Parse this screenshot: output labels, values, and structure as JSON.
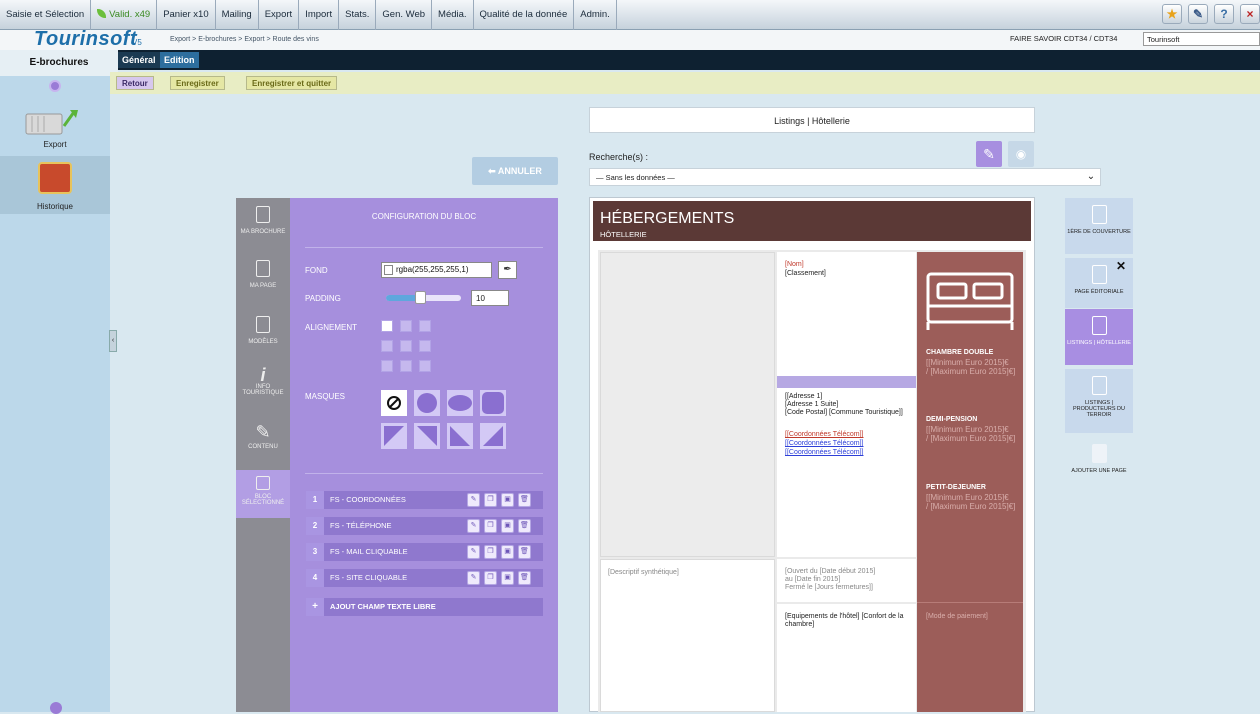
{
  "menu": {
    "items": [
      "Saisie et Sélection",
      "Valid. x49",
      "Panier x10",
      "Mailing",
      "Export",
      "Import",
      "Stats.",
      "Gen. Web",
      "Média.",
      "Qualité de la donnée",
      "Admin."
    ]
  },
  "top_icons": [
    "star-icon",
    "wrench-icon",
    "help-icon",
    "close-icon"
  ],
  "app": {
    "logo": "Tourinsoft",
    "version": "V5",
    "breadcrumb": "Export > E-brochures > Export > Route des vins",
    "org": "FAIRE SAVOIR CDT34 / CDT34",
    "org_select": "Tourinsoft"
  },
  "tabs": {
    "general": "Général",
    "edition": "Edition"
  },
  "sidebar": {
    "title": "E-brochures",
    "export_label": "Export",
    "historique_label": "Historique"
  },
  "actions": {
    "retour": "Retour",
    "enregistrer": "Enregistrer",
    "enregistrer_quitter": "Enregistrer et quitter"
  },
  "annuler_label": "ANNULER",
  "config": {
    "tabs": [
      "MA BROCHURE",
      "MA PAGE",
      "MODÈLES",
      "INFO TOURISTIQUE",
      "CONTENU",
      "BLOC SÉLECTIONNÉ"
    ],
    "title": "CONFIGURATION DU BLOC",
    "fond_label": "FOND",
    "fond_value": "rgba(255,255,255,1)",
    "padding_label": "PADDING",
    "padding_value": "10",
    "padding_level": 0.45,
    "alignement_label": "ALIGNEMENT",
    "masques_label": "MASQUES",
    "fields": [
      {
        "num": "1",
        "label": "FS - COORDONNÉES"
      },
      {
        "num": "2",
        "label": "FS - TÉLÉPHONE"
      },
      {
        "num": "3",
        "label": "FS - MAIL CLIQUABLE"
      },
      {
        "num": "4",
        "label": "FS - SITE CLIQUABLE"
      }
    ],
    "add_field": "AJOUT CHAMP TEXTE LIBRE"
  },
  "main": {
    "listings_title": "Listings | Hôtellerie",
    "search_label": "Recherche(s) :",
    "search_value": "— Sans les données —"
  },
  "doc": {
    "title": "HÉBERGEMENTS",
    "subtitle": "HÔTELLERIE",
    "nom": "[Nom]",
    "classement": "[Classement]",
    "adresse": "[[Adresse 1]\n[Adresse 1 Suite]\n[Code Postal] [Commune Touristique]]",
    "tel1": "[[Coordonnées Télécom]]",
    "tel2": "[[Coordonnées Télécom]]",
    "tel3": "[[Coordonnées Télécom]]",
    "ch_title": "CHAMBRE DOUBLE",
    "ch_val": "[[Minimum Euro 2015]€\n/ [Maximum Euro 2015]€]",
    "dp_title": "DEMI-PENSION",
    "dp_val": "[[Minimum Euro 2015]€\n/ [Maximum Euro 2015]€]",
    "pd_title": "PETIT-DEJEUNER",
    "pd_val": "[[Minimum Euro 2015]€\n/ [Maximum Euro 2015]€]",
    "descriptif": "[Descriptif synthétique]",
    "ouverture": "[Ouvert du [Date début 2015]\nau [Date fin 2015]\nFermé le [Jours fermetures]]",
    "equipements": "[Equipements de l'hôtel] [Confort de la chambre]",
    "paiement": "[Mode de paiement]"
  },
  "pages": [
    "1ÈRE DE COUVERTURE",
    "PAGE ÉDITORIALE",
    "LISTINGS | HÔTELLERIE",
    "LISTINGS | PRODUCTEURS DU TERROIR",
    "AJOUTER UNE PAGE"
  ]
}
